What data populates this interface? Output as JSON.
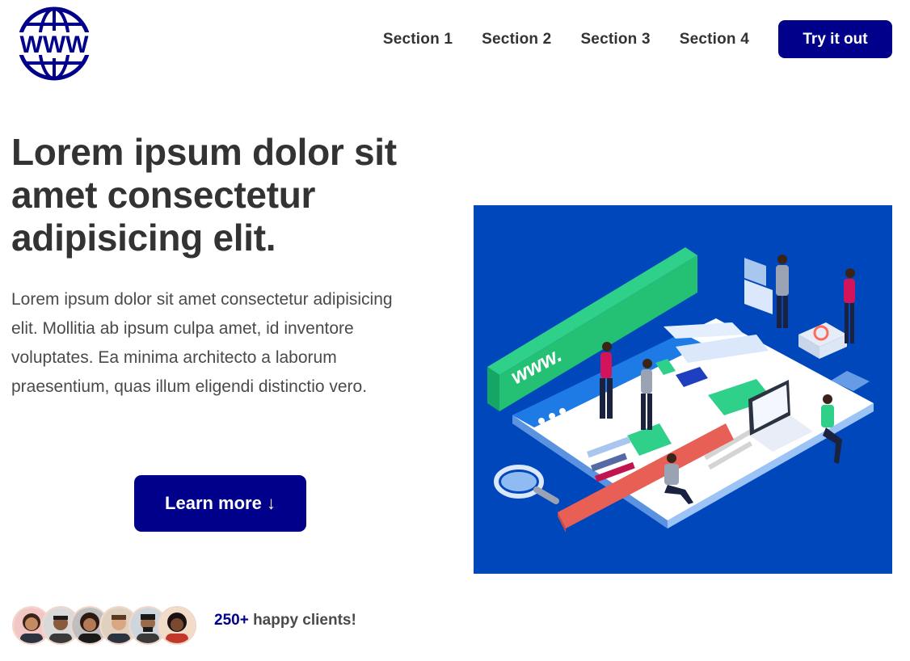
{
  "header": {
    "logo_text": "WWW",
    "nav": [
      {
        "label": "Section 1"
      },
      {
        "label": "Section 2"
      },
      {
        "label": "Section 3"
      },
      {
        "label": "Section 4"
      }
    ],
    "cta_label": "Try it out"
  },
  "hero": {
    "title": "Lorem ipsum dolor sit amet consectetur adipisicing elit.",
    "text": "Lorem ipsum dolor sit amet consectetur adipisicing elit. Mollitia ab ipsum culpa amet, id inventore voluptates. Ea minima architecto a laborum praesentium, quas illum eligendi distinctio vero.",
    "button_label": "Learn more ↓",
    "illustration_text": "www."
  },
  "clients": {
    "count": "250+",
    "label": " happy clients!"
  },
  "colors": {
    "brand": "#00008b",
    "illustration_bg": "#0047bb",
    "text": "#333333"
  }
}
